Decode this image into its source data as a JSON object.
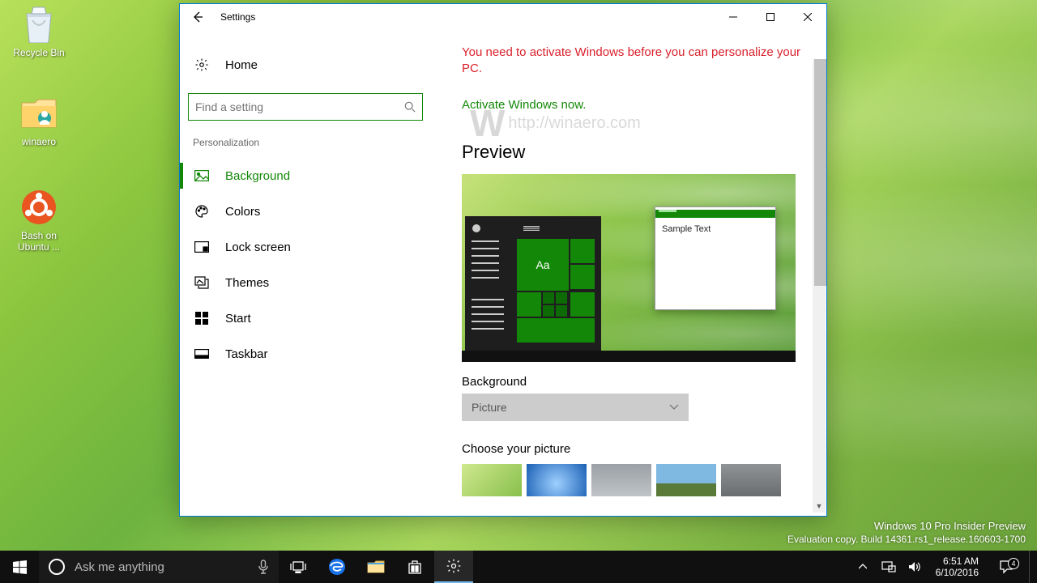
{
  "desktop": {
    "icons": [
      {
        "label": "Recycle Bin"
      },
      {
        "label": "winaero"
      },
      {
        "label": "Bash on Ubuntu ..."
      }
    ]
  },
  "window": {
    "title": "Settings",
    "home": "Home",
    "search_placeholder": "Find a setting",
    "section": "Personalization",
    "nav": {
      "background": "Background",
      "colors": "Colors",
      "lockscreen": "Lock screen",
      "themes": "Themes",
      "start": "Start",
      "taskbar": "Taskbar"
    },
    "activation_warning": "You need to activate Windows before you can personalize your PC.",
    "activate_link": "Activate Windows now.",
    "watermark": "http://winaero.com",
    "preview_heading": "Preview",
    "sample_text": "Sample Text",
    "aa": "Aa",
    "bg_label": "Background",
    "bg_value": "Picture",
    "choose_label": "Choose your picture"
  },
  "desktop_watermark": {
    "line1": "Windows 10 Pro Insider Preview",
    "line2": "Evaluation copy. Build 14361.rs1_release.160603-1700"
  },
  "taskbar": {
    "cortana_placeholder": "Ask me anything",
    "clock_time": "6:51 AM",
    "clock_date": "6/10/2016",
    "notif_count": "4"
  }
}
